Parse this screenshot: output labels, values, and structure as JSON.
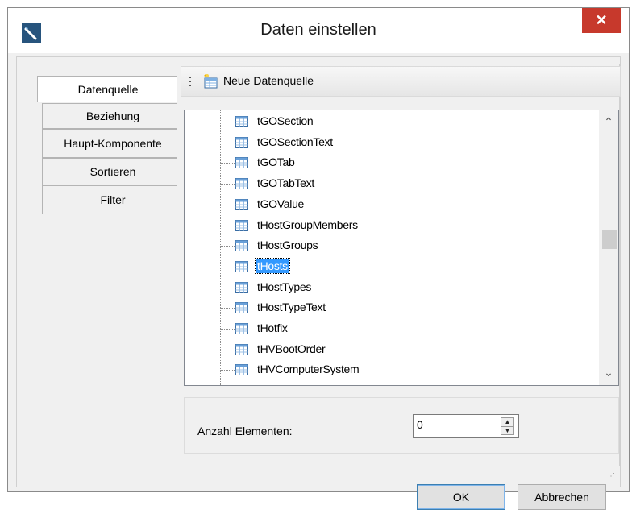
{
  "window": {
    "title": "Daten einstellen",
    "close_label": "✕"
  },
  "tabs": [
    {
      "label": "Datenquelle",
      "active": true
    },
    {
      "label": "Beziehung",
      "active": false
    },
    {
      "label": "Haupt-Komponente",
      "active": false
    },
    {
      "label": "Sortieren",
      "active": false
    },
    {
      "label": "Filter",
      "active": false
    }
  ],
  "toolbar": {
    "new_datasource_label": "Neue Datenquelle"
  },
  "tree": {
    "items": [
      {
        "label": "tGOSection"
      },
      {
        "label": "tGOSectionText"
      },
      {
        "label": "tGOTab"
      },
      {
        "label": "tGOTabText"
      },
      {
        "label": "tGOValue"
      },
      {
        "label": "tHostGroupMembers"
      },
      {
        "label": "tHostGroups"
      },
      {
        "label": "tHosts",
        "selected": true
      },
      {
        "label": "tHostTypes"
      },
      {
        "label": "tHostTypeText"
      },
      {
        "label": "tHotfix"
      },
      {
        "label": "tHVBootOrder"
      },
      {
        "label": "tHVComputerSystem"
      }
    ],
    "scroll_up_glyph": "⌃",
    "scroll_down_glyph": "⌄"
  },
  "count": {
    "label": "Anzahl Elementen:",
    "value": "0"
  },
  "buttons": {
    "ok_label": "OK",
    "cancel_label": "Abbrechen"
  },
  "colors": {
    "close_button": "#c7392c",
    "selection": "#3399ff",
    "app_icon": "#27547d"
  }
}
